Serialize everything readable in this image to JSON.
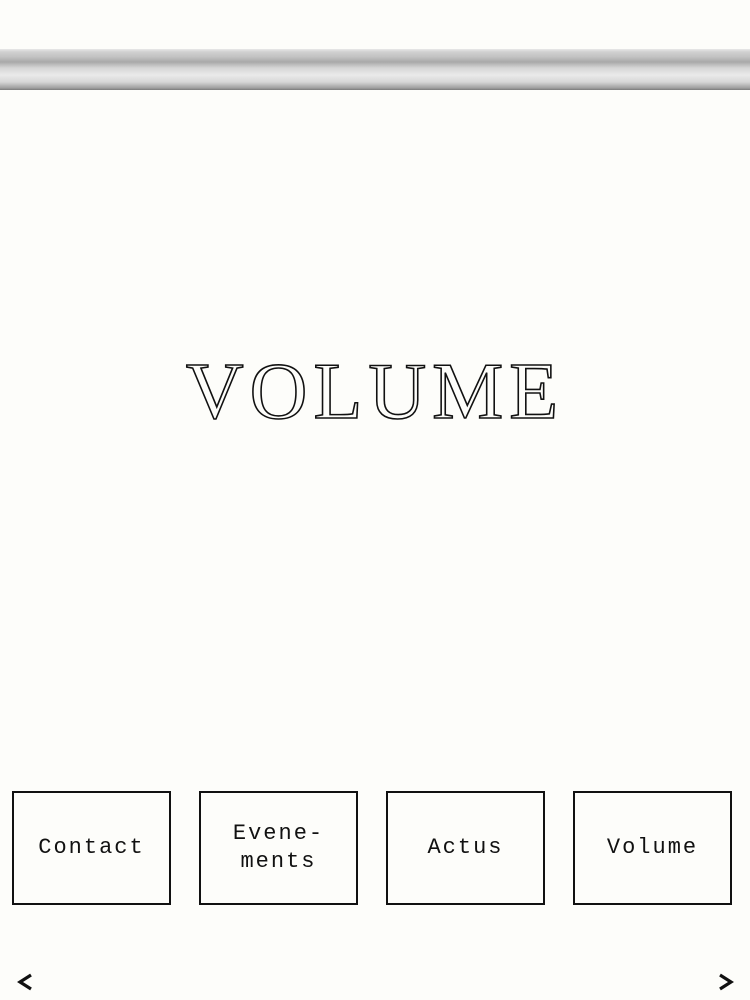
{
  "hero": {
    "title": "VOLUME"
  },
  "nav": {
    "buttons": [
      {
        "label": "Contact"
      },
      {
        "label": "Evene-\nments"
      },
      {
        "label": "Actus"
      },
      {
        "label": "Volume"
      }
    ]
  },
  "pager": {
    "prev_icon": "chevron-left-icon",
    "next_icon": "chevron-right-icon"
  }
}
